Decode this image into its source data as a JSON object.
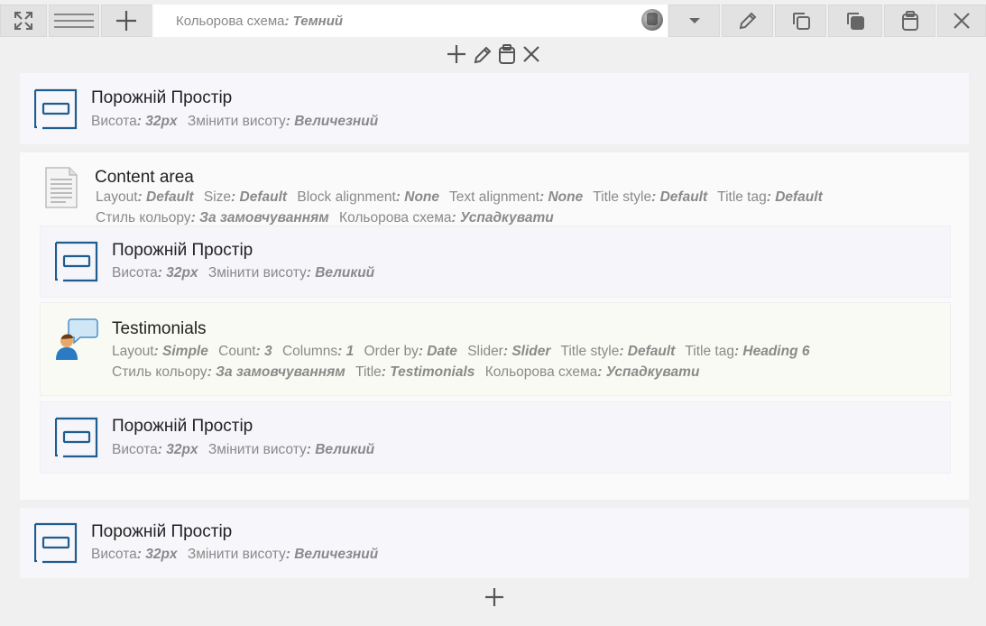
{
  "toolbar": {
    "scheme_label": "Кольорова схема",
    "scheme_sep": ":",
    "scheme_value": "Темний"
  },
  "blocks": {
    "spacer_top": {
      "title": "Порожній Простір",
      "meta": [
        {
          "k": "Висота",
          "v": "32px"
        },
        {
          "k": "Змінити висоту",
          "v": "Величезний"
        }
      ]
    },
    "content_area": {
      "title": "Content area",
      "meta": [
        {
          "k": "Layout",
          "v": "Default"
        },
        {
          "k": "Size",
          "v": "Default"
        },
        {
          "k": "Block alignment",
          "v": "None"
        },
        {
          "k": "Text alignment",
          "v": "None"
        },
        {
          "k": "Title style",
          "v": "Default"
        },
        {
          "k": "Title tag",
          "v": "Default"
        },
        {
          "k": "Стиль кольору",
          "v": "За замовчуванням"
        },
        {
          "k": "Кольорова схема",
          "v": "Успадкувати"
        }
      ]
    },
    "spacer_inner_1": {
      "title": "Порожній Простір",
      "meta": [
        {
          "k": "Висота",
          "v": "32px"
        },
        {
          "k": "Змінити висоту",
          "v": "Великий"
        }
      ]
    },
    "testimonials": {
      "title": "Testimonials",
      "meta": [
        {
          "k": "Layout",
          "v": "Simple"
        },
        {
          "k": "Count",
          "v": "3"
        },
        {
          "k": "Columns",
          "v": "1"
        },
        {
          "k": "Order by",
          "v": "Date"
        },
        {
          "k": "Slider",
          "v": "Slider"
        },
        {
          "k": "Title style",
          "v": "Default"
        },
        {
          "k": "Title tag",
          "v": "Heading 6"
        },
        {
          "k": "Стиль кольору",
          "v": "За замовчуванням"
        },
        {
          "k": "Title",
          "v": "Testimonials"
        },
        {
          "k": "Кольорова схема",
          "v": "Успадкувати"
        }
      ]
    },
    "spacer_inner_2": {
      "title": "Порожній Простір",
      "meta": [
        {
          "k": "Висота",
          "v": "32px"
        },
        {
          "k": "Змінити висоту",
          "v": "Великий"
        }
      ]
    },
    "spacer_bottom": {
      "title": "Порожній Простір",
      "meta": [
        {
          "k": "Висота",
          "v": "32px"
        },
        {
          "k": "Змінити висоту",
          "v": "Величезний"
        }
      ]
    }
  },
  "icons": {
    "fullscreen": "expand-icon",
    "menu": "hamburger-icon",
    "add": "plus-icon",
    "dropdown": "caret-down-icon",
    "edit": "pencil-icon",
    "copy": "copy-icon",
    "paste": "paste-icon",
    "clipboard": "clipboard-icon",
    "close": "close-icon"
  },
  "colors": {
    "accent_blue": "#1f5c8f",
    "toolbar_button": "#e2e2e2"
  }
}
